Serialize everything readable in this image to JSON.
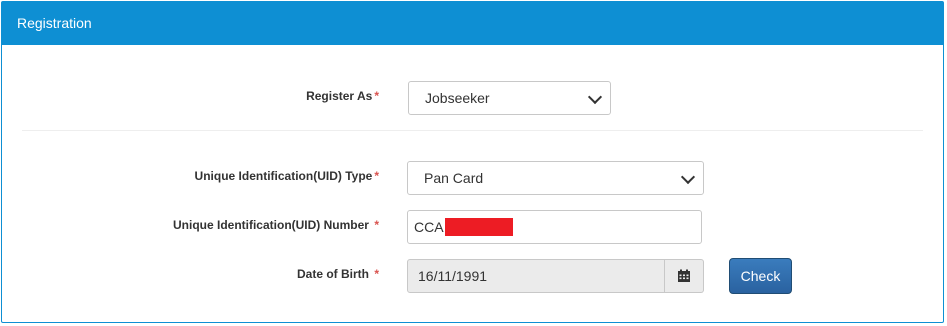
{
  "panel": {
    "title": "Registration"
  },
  "register_as": {
    "label": "Register As",
    "required_mark": "*",
    "selected": "Jobseeker"
  },
  "uid_type": {
    "label": "Unique Identification(UID) Type",
    "required_mark": "*",
    "selected": "Pan Card"
  },
  "uid_number": {
    "label": "Unique Identification(UID) Number ",
    "required_mark": "*",
    "value_visible": "CCA",
    "redaction_color": "#ed1c24"
  },
  "dob": {
    "label": "Date of Birth ",
    "required_mark": "*",
    "value": "16/11/1991"
  },
  "check_button": {
    "label": "Check"
  },
  "colors": {
    "header_bg": "#0e8fd3",
    "required": "#d9534f",
    "primary_button": "#2a62a0"
  },
  "icons": {
    "select_arrow": "chevron-down-icon",
    "calendar": "calendar-icon"
  }
}
